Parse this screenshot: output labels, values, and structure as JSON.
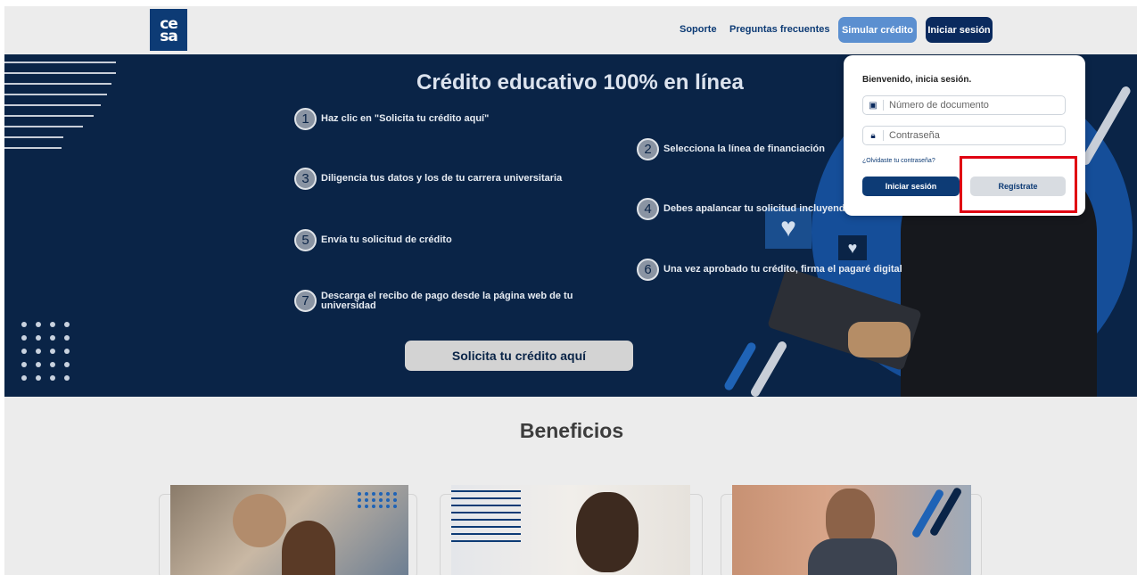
{
  "header": {
    "logo_text": [
      "ce",
      "sa"
    ],
    "links": [
      "Soporte",
      "Preguntas frecuentes"
    ],
    "simulate_label": "Simular crédito",
    "login_label": "Iniciar sesión"
  },
  "hero": {
    "title": "Crédito educativo 100% en línea",
    "steps": [
      {
        "num": "1",
        "text": "Haz clic en \"Solicita tu crédito aquí\""
      },
      {
        "num": "2",
        "text": "Selecciona la línea de financiación"
      },
      {
        "num": "3",
        "text": "Diligencia tus datos y los de tu carrera universitaria"
      },
      {
        "num": "4",
        "text": "Debes apalancar tu solicitud incluyendo"
      },
      {
        "num": "5",
        "text": "Envía tu solicitud de crédito"
      },
      {
        "num": "6",
        "text": "Una vez aprobado tu crédito, firma el pagaré digital"
      },
      {
        "num": "7",
        "text": "Descarga el recibo de pago desde la página web de tu universidad"
      }
    ],
    "cta_label": "Solicita tu crédito aquí"
  },
  "login": {
    "title": "Bienvenido, inicia sesión.",
    "document_placeholder": "Número de documento",
    "password_placeholder": "Contraseña",
    "forgot_label": "¿Olvidaste tu contraseña?",
    "submit_label": "Iniciar sesión",
    "register_label": "Regístrate"
  },
  "benefits": {
    "title": "Beneficios"
  },
  "colors": {
    "brand_navy": "#0a2447",
    "accent_blue": "#154e99",
    "highlight_red": "#e00012"
  }
}
